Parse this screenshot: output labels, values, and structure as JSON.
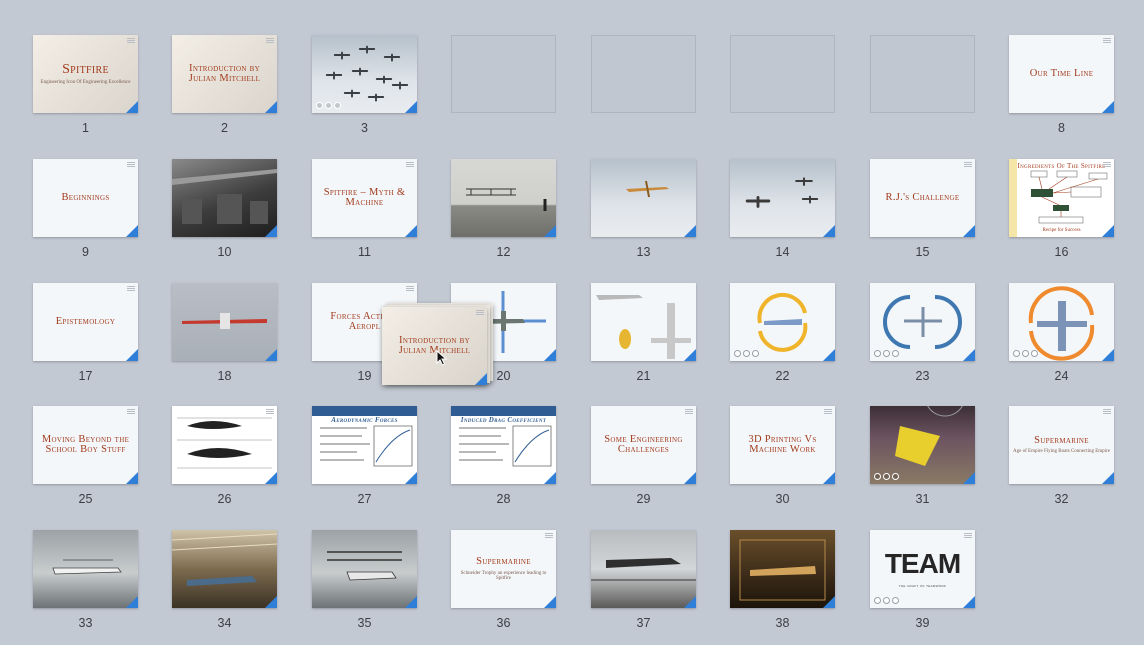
{
  "colors": {
    "background": "#c3c9d3",
    "title_text": "#a23b1c",
    "corner_marker": "#2f7ed8",
    "label_text": "#3b3f45"
  },
  "slides": [
    {
      "num": "1",
      "kind": "title",
      "title": "Spitfire",
      "subtitle": "Engineering Icon Of Engineering Excellence",
      "big": true,
      "notes": true
    },
    {
      "num": "2",
      "kind": "title",
      "title": "Introduction by Julian Mitchell",
      "notes": true
    },
    {
      "num": "3",
      "kind": "sky",
      "build": true,
      "art": "formation-icon"
    },
    {
      "num": "",
      "kind": "blank"
    },
    {
      "num": "",
      "kind": "blank"
    },
    {
      "num": "",
      "kind": "blank"
    },
    {
      "num": "",
      "kind": "blank"
    },
    {
      "num": "8",
      "kind": "text",
      "title": "Our Time Line",
      "notes": true
    },
    {
      "num": "9",
      "kind": "text",
      "title": "Beginnings",
      "notes": true
    },
    {
      "num": "10",
      "kind": "photo-bw",
      "art": "factory-photo-icon"
    },
    {
      "num": "11",
      "kind": "text",
      "title": "Spitfire – Myth & Machine",
      "notes": true
    },
    {
      "num": "12",
      "kind": "bwgrass",
      "art": "wright-flyer-icon"
    },
    {
      "num": "13",
      "kind": "sky",
      "art": "monoplane-icon"
    },
    {
      "num": "14",
      "kind": "sky",
      "art": "biplanes-icon"
    },
    {
      "num": "15",
      "kind": "text",
      "title": "R.J.'s Challenge",
      "notes": true
    },
    {
      "num": "16",
      "kind": "diagram",
      "title": "Ingredients Of The Spitfire",
      "subtitle": "Recipe for Success",
      "notes": true
    },
    {
      "num": "17",
      "kind": "text",
      "title": "Epistemology",
      "notes": true
    },
    {
      "num": "18",
      "kind": "grey",
      "art": "red-plane-icon"
    },
    {
      "num": "19",
      "kind": "text",
      "title": "Forces Acti An Aeropl",
      "notes": true
    },
    {
      "num": "20",
      "kind": "text",
      "art": "forces-arrows-icon"
    },
    {
      "num": "21",
      "kind": "text",
      "art": "spitfire-views-icon"
    },
    {
      "num": "22",
      "kind": "text",
      "build": true,
      "art": "yellow-cycle-icon"
    },
    {
      "num": "23",
      "kind": "text",
      "build": true,
      "art": "blue-cycle-icon"
    },
    {
      "num": "24",
      "kind": "text",
      "build": true,
      "art": "orange-cycle-icon"
    },
    {
      "num": "25",
      "kind": "text",
      "title": "Moving Beyond the School Boy Stuff",
      "notes": true
    },
    {
      "num": "26",
      "kind": "diagram",
      "art": "airfoil-sketch-icon",
      "notes": true
    },
    {
      "num": "27",
      "kind": "diagram",
      "title": "Aerodynamic Forces",
      "art": "nasa-slide-icon"
    },
    {
      "num": "28",
      "kind": "diagram",
      "title": "Induced Drag Coefficient",
      "art": "nasa-slide-icon"
    },
    {
      "num": "29",
      "kind": "text",
      "title": "Some Engineering Challenges",
      "notes": true
    },
    {
      "num": "30",
      "kind": "text",
      "title": "3D Printing Vs Machine Work",
      "notes": true
    },
    {
      "num": "31",
      "kind": "craft",
      "build": true,
      "art": "3d-print-photo-icon"
    },
    {
      "num": "32",
      "kind": "text",
      "title": "Supermarine",
      "subtitle": "Age of Empire Flying Boats Connecting Empire",
      "notes": true
    },
    {
      "num": "33",
      "kind": "seaplane",
      "art": "flying-boat-icon"
    },
    {
      "num": "34",
      "kind": "museum",
      "art": "museum-photo-icon"
    },
    {
      "num": "35",
      "kind": "seaplane",
      "art": "seaplane-photo-icon"
    },
    {
      "num": "36",
      "kind": "text",
      "title": "Supermarine",
      "subtitle": "Schneider Trophy an experience leading to Spitfire",
      "notes": true
    },
    {
      "num": "37",
      "kind": "bwfield",
      "art": "hangar-photo-icon"
    },
    {
      "num": "38",
      "kind": "workshop",
      "art": "workshop-photo-icon"
    },
    {
      "num": "39",
      "kind": "team",
      "title": "TEAM",
      "subtitle": "the craft of teamwork",
      "build": true,
      "notes": true
    }
  ],
  "dragged_slide": {
    "title": "Introduction by Julian Mitchell"
  }
}
